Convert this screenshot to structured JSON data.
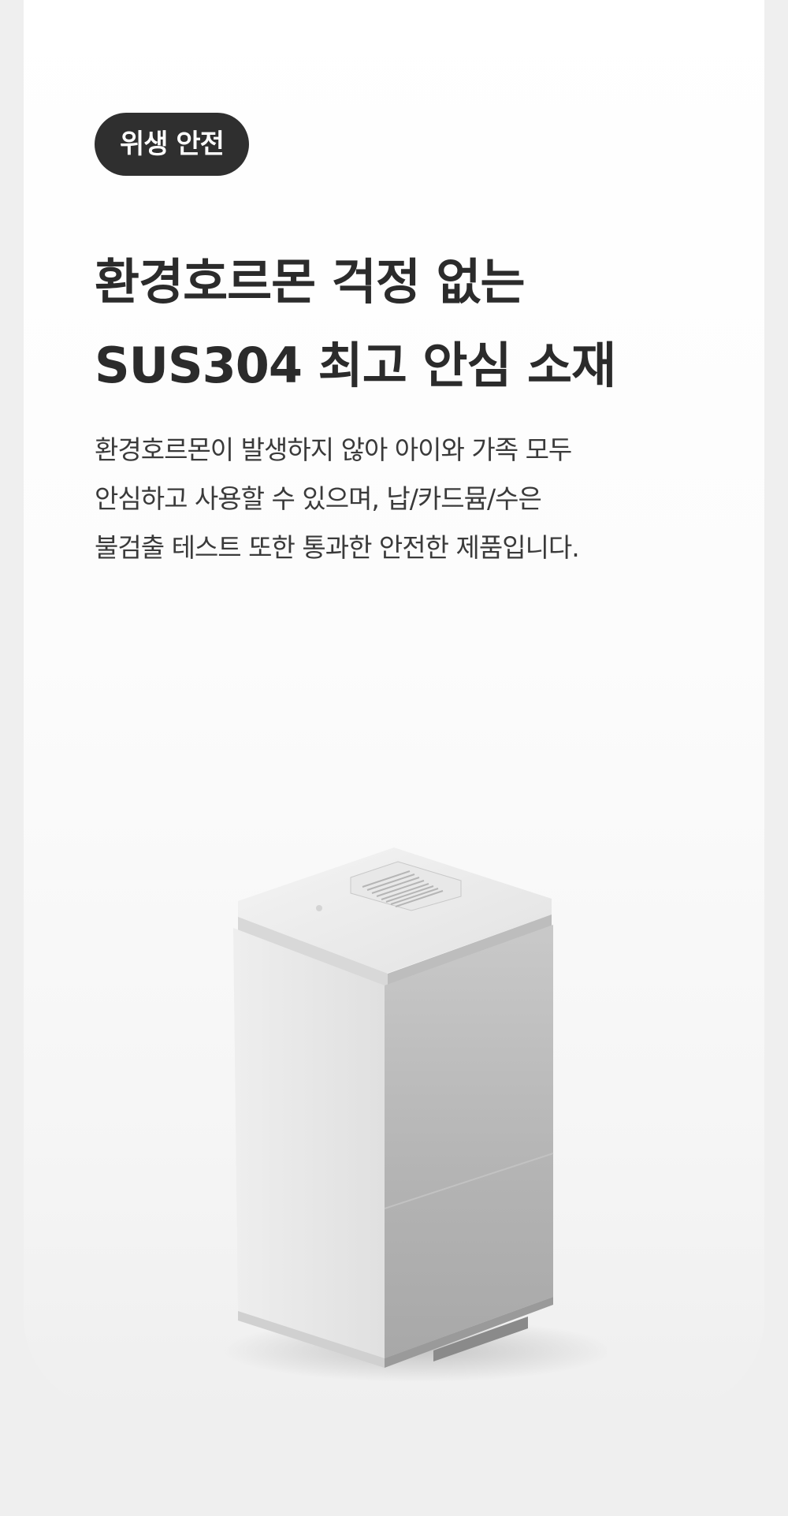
{
  "badge": {
    "label": "위생 안전"
  },
  "headline": {
    "lines": [
      "환경호르몬 걱정 없는",
      "SUS304 최고 안심 소재"
    ]
  },
  "description": {
    "lines": [
      "환경호르몬이 발생하지 않아 아이와 가족 모두",
      "안심하고 사용할 수 있으며, 납/카드뮴/수은",
      "불검출 테스트 또한 통과한 안전한 제품입니다."
    ]
  },
  "product": {
    "image": "white-appliance-product-image"
  },
  "colors": {
    "page_background": "#efefef",
    "card_background": "#ffffff",
    "badge_background": "#2f2f2f",
    "badge_text": "#ffffff",
    "headline_text": "#2b2b2b",
    "description_text": "#3a3a3a"
  }
}
